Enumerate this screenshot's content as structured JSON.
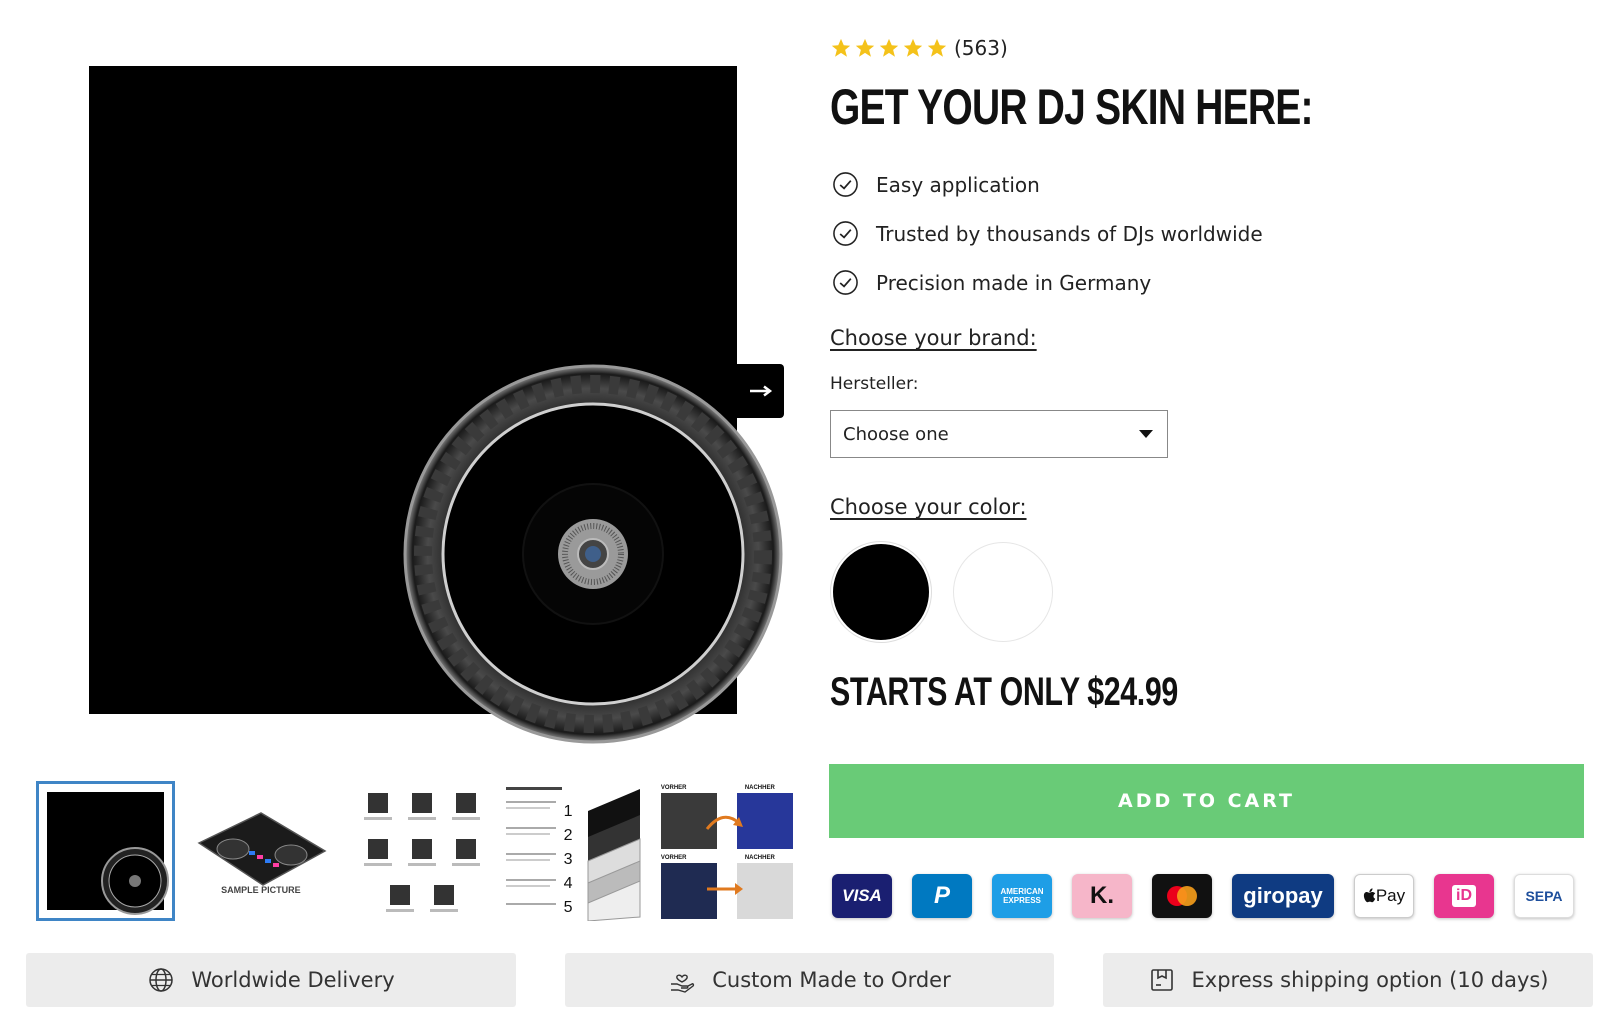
{
  "rating": {
    "stars": 5,
    "count": "(563)",
    "star_color": "#f4c21a"
  },
  "product": {
    "title": "GET YOUR DJ SKIN HERE:",
    "features": [
      "Easy application",
      "Trusted by thousands of DJs worldwide",
      "Precision made in Germany"
    ],
    "brand_heading": "Choose your brand:",
    "manufacturer_label": "Hersteller:",
    "manufacturer_selected": "Choose one",
    "color_heading": "Choose your color:",
    "colors": [
      "#000000",
      "#ffffff"
    ],
    "price": "STARTS AT ONLY $24.99",
    "add_to_cart": "ADD TO CART",
    "cta_color": "#69cb77"
  },
  "gallery": {
    "thumbs": [
      {
        "kind": "black-skin"
      },
      {
        "kind": "controller",
        "label": "SAMPLE PICTURE"
      },
      {
        "kind": "feature-icons"
      },
      {
        "kind": "layers",
        "numbers": [
          "1",
          "2",
          "3",
          "4",
          "5"
        ]
      },
      {
        "kind": "before-after",
        "labels": [
          "VORHER",
          "NACHHER",
          "VORHER",
          "NACHHER"
        ]
      }
    ]
  },
  "payments": [
    {
      "name": "visa-icon",
      "text": "VISA",
      "bg": "#1a1f71",
      "fg": "#ffffff"
    },
    {
      "name": "paypal-icon",
      "text": "P",
      "bg": "#0079c1",
      "fg": "#ffffff"
    },
    {
      "name": "amex-icon",
      "text": "AMERICAN EXPRESS",
      "bg": "#1e9ee6",
      "fg": "#ffffff"
    },
    {
      "name": "klarna-icon",
      "text": "K.",
      "bg": "#f6b6c9",
      "fg": "#111111"
    },
    {
      "name": "mastercard-icon",
      "text": "",
      "bg": "#111111",
      "fg": "#ffffff"
    },
    {
      "name": "giropay-icon",
      "text": "giropay",
      "bg": "#0f3b82",
      "fg": "#ffffff"
    },
    {
      "name": "apple-pay-icon",
      "text": "Pay",
      "bg": "#ffffff",
      "fg": "#111111"
    },
    {
      "name": "ideal-icon",
      "text": "iD",
      "bg": "#e8368f",
      "fg": "#ffffff"
    },
    {
      "name": "sepa-icon",
      "text": "SEPA",
      "bg": "#ffffff",
      "fg": "#1e4f9c"
    }
  ],
  "benefits": [
    {
      "text": "Worldwide Delivery"
    },
    {
      "text": "Custom Made to Order"
    },
    {
      "text": "Express shipping option (10 days)"
    }
  ]
}
